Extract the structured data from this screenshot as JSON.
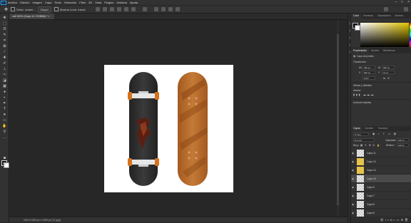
{
  "menu": [
    "Archivo",
    "Edición",
    "Imagen",
    "Capa",
    "Texto",
    "Selección",
    "Filtro",
    "3D",
    "Vista",
    "Plugins",
    "Ventana",
    "Ayuda"
  ],
  "app_logo": "Ps",
  "options": {
    "auto_select_label": "Selec. autom.:",
    "auto_select_value": "Grupo",
    "show_transform_label": "Mostrar contr. transf."
  },
  "document_tab": "vall 100% (Capa 10, RGB/8#) *",
  "status": "100 %   1000 px x 1000 px (72 ppp)",
  "color_panel": {
    "tabs": [
      "Color",
      "Muestras",
      "Degradados",
      "Motivos"
    ]
  },
  "properties_panel": {
    "tabs": [
      "Propiedades",
      "Ajustes",
      "Bibliotecas"
    ],
    "layer_type": "Capa de píxeles",
    "transform_title": "Transformar",
    "fields": [
      {
        "label": "An",
        "value": "360 px"
      },
      {
        "label": "Al",
        "value": "360 px"
      },
      {
        "label": "X",
        "value": "360 px"
      },
      {
        "label": "Y",
        "value": "14 px"
      }
    ],
    "angle": "0,00°",
    "align_title": "Alinear y distribuir",
    "align_sub": "Alinear:",
    "quick_actions": "Acciones rápidas"
  },
  "layers_panel": {
    "tabs": [
      "Capas",
      "Canales",
      "Trazados"
    ],
    "filter_label": "Tipo",
    "blend_mode": "Normal",
    "opacity_label": "Opacidad:",
    "opacity_value": "100 %",
    "lock_label": "Bloq.:",
    "fill_label": "Relleno:",
    "fill_value": "100 %",
    "layers": [
      {
        "name": "Capa 11",
        "art": false,
        "selected": false
      },
      {
        "name": "Capa 12",
        "art": true,
        "selected": false
      },
      {
        "name": "Capa 13",
        "art": true,
        "selected": false
      },
      {
        "name": "Capa 10",
        "art": false,
        "selected": true
      },
      {
        "name": "Capa 9",
        "art": false,
        "selected": false
      },
      {
        "name": "Capa 7",
        "art": false,
        "selected": false
      },
      {
        "name": "Capa 8",
        "art": false,
        "selected": false
      },
      {
        "name": "Capa 6",
        "art": false,
        "selected": false
      }
    ]
  },
  "colors": {
    "board_dark": "#2b2b2b",
    "board_wood": "#b96b2b",
    "truck_orange": "#d6721e"
  }
}
